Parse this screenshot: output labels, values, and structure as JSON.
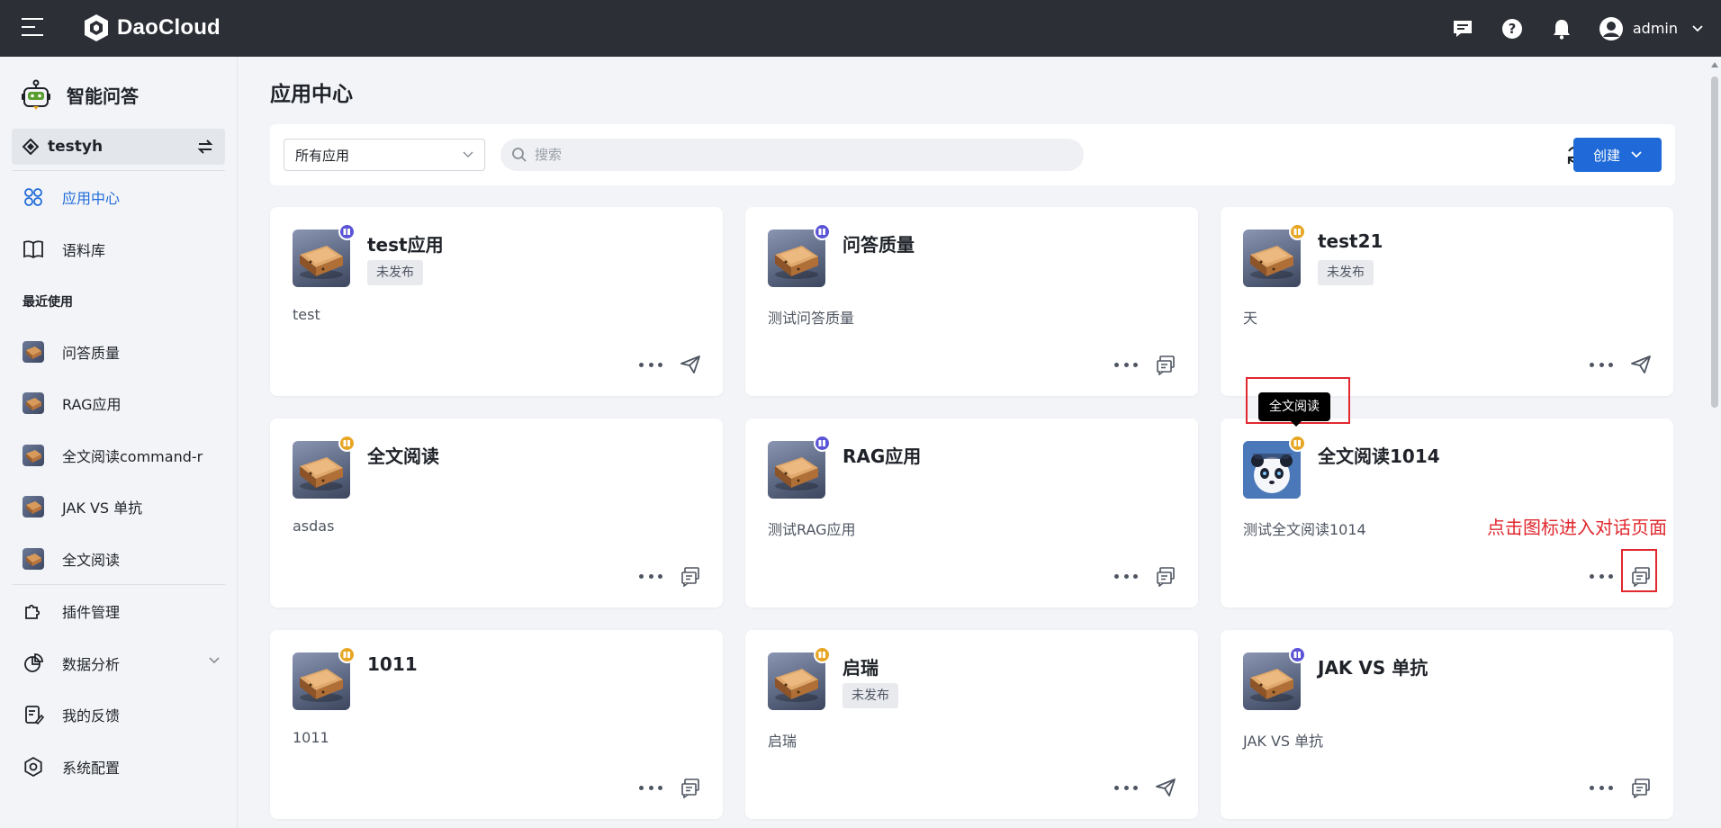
{
  "app": {
    "brand": "DaoCloud",
    "user": "admin"
  },
  "sidebar": {
    "title": "智能问答",
    "workspace": "testyh",
    "nav_top": [
      {
        "label": "应用中心",
        "icon": "grid-icon",
        "active": true
      },
      {
        "label": "语料库",
        "icon": "book-icon",
        "active": false
      }
    ],
    "recent_title": "最近使用",
    "recent": [
      {
        "label": "问答质量"
      },
      {
        "label": "RAG应用"
      },
      {
        "label": "全文阅读command-r"
      },
      {
        "label": "JAK VS 单抗"
      },
      {
        "label": "全文阅读"
      }
    ],
    "nav_bottom": [
      {
        "label": "插件管理",
        "icon": "puzzle-icon"
      },
      {
        "label": "数据分析",
        "icon": "pie-chart-icon"
      },
      {
        "label": "我的反馈",
        "icon": "feedback-icon"
      },
      {
        "label": "系统配置",
        "icon": "gear-icon"
      }
    ]
  },
  "main": {
    "title": "应用中心",
    "filter": {
      "selected": "所有应用"
    },
    "search": {
      "placeholder": "搜索",
      "value": ""
    },
    "create_label": "创建",
    "cards": [
      {
        "title": "test应用",
        "tag": "未发布",
        "desc": "test",
        "badge": "purple",
        "action": "send-icon",
        "avatar": "book"
      },
      {
        "title": "问答质量",
        "tag": "",
        "desc": "测试问答质量",
        "badge": "purple",
        "action": "chat-icon",
        "avatar": "book"
      },
      {
        "title": "test21",
        "tag": "未发布",
        "desc": "天",
        "badge": "orange",
        "action": "send-icon",
        "avatar": "book"
      },
      {
        "title": "全文阅读",
        "tag": "",
        "desc": "asdas",
        "badge": "orange",
        "action": "chat-icon",
        "avatar": "book"
      },
      {
        "title": "RAG应用",
        "tag": "",
        "desc": "测试RAG应用",
        "badge": "purple",
        "action": "chat-icon",
        "avatar": "book"
      },
      {
        "title": "全文阅读1014",
        "tag": "",
        "desc": "测试全文阅读1014",
        "badge": "orange",
        "action": "chat-icon",
        "avatar": "panda"
      },
      {
        "title": "1011",
        "tag": "",
        "desc": "1011",
        "badge": "orange",
        "action": "chat-icon",
        "avatar": "book"
      },
      {
        "title": "启瑞",
        "tag": "未发布",
        "desc": "启瑞",
        "badge": "orange",
        "action": "send-icon",
        "avatar": "book"
      },
      {
        "title": "JAK VS 单抗",
        "tag": "",
        "desc": "JAK VS 单抗",
        "badge": "purple",
        "action": "chat-icon",
        "avatar": "book"
      }
    ]
  },
  "annotations": {
    "tooltip": "全文阅读",
    "note": "点击图标进入对话页面"
  },
  "colors": {
    "accent": "#1f6ad8",
    "topbar": "#2c2f36",
    "annotation_red": "#e0282e",
    "badge_purple": "#5b54d6",
    "badge_orange": "#e7a624"
  }
}
